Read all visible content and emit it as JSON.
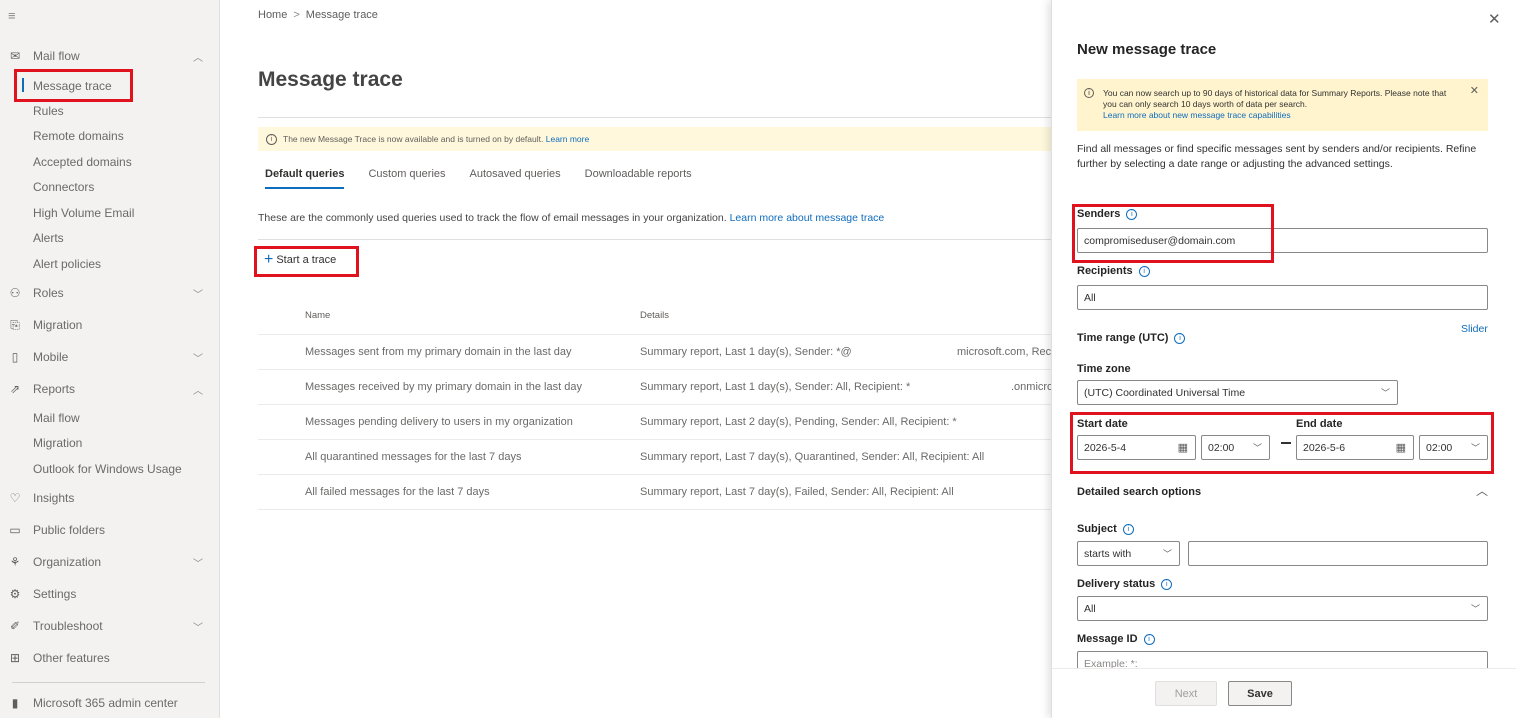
{
  "sidebar": {
    "menu_icon": "hamburger-icon",
    "mail_flow": {
      "label": "Mail flow",
      "icon": "mail-icon"
    },
    "mail_flow_items": [
      "Message trace",
      "Rules",
      "Remote domains",
      "Accepted domains",
      "Connectors",
      "High Volume Email",
      "Alerts",
      "Alert policies"
    ],
    "roles": {
      "label": "Roles",
      "icon": "roles-icon"
    },
    "migration": {
      "label": "Migration",
      "icon": "migration-icon"
    },
    "mobile": {
      "label": "Mobile",
      "icon": "mobile-icon"
    },
    "reports": {
      "label": "Reports",
      "icon": "reports-icon"
    },
    "reports_items": [
      "Mail flow",
      "Migration",
      "Outlook for Windows Usage"
    ],
    "insights": {
      "label": "Insights",
      "icon": "insights-icon"
    },
    "public_folders": {
      "label": "Public folders",
      "icon": "public-folders-icon"
    },
    "organization": {
      "label": "Organization",
      "icon": "organization-icon"
    },
    "settings": {
      "label": "Settings",
      "icon": "settings-icon"
    },
    "troubleshoot": {
      "label": "Troubleshoot",
      "icon": "troubleshoot-icon"
    },
    "other_features": {
      "label": "Other features",
      "icon": "grid-icon"
    },
    "admin_center": {
      "label": "Microsoft 365 admin center",
      "icon": "office-icon"
    }
  },
  "main": {
    "breadcrumb": {
      "home": "Home",
      "separator": ">",
      "current": "Message trace"
    },
    "title": "Message trace",
    "banner": {
      "text": "The new Message Trace is now available and is turned on by default.",
      "link": "Learn more"
    },
    "tabs": [
      "Default queries",
      "Custom queries",
      "Autosaved queries",
      "Downloadable reports"
    ],
    "description": {
      "text": "These are the commonly used queries used to track the flow of email messages in your organization.",
      "link": "Learn more about message trace"
    },
    "start_trace": {
      "plus": "+",
      "label": "Start a trace"
    },
    "columns": {
      "name": "Name",
      "details": "Details"
    },
    "rows": [
      {
        "name": "Messages sent from my primary domain in the last day",
        "details": "Summary report, Last 1 day(s), Sender: *@",
        "extra": "microsoft.com, Rec"
      },
      {
        "name": "Messages received by my primary domain in the last day",
        "details": "Summary report, Last 1 day(s), Sender: All, Recipient: *",
        "extra": ".onmicro"
      },
      {
        "name": "Messages pending delivery to users in my organization",
        "details": "Summary report, Last 2 day(s), Pending, Sender: All, Recipient: *",
        "extra": ""
      },
      {
        "name": "All quarantined messages for the last 7 days",
        "details": "Summary report, Last 7 day(s), Quarantined, Sender: All, Recipient: All",
        "extra": ""
      },
      {
        "name": "All failed messages for the last 7 days",
        "details": "Summary report, Last 7 day(s), Failed, Sender: All, Recipient: All",
        "extra": ""
      }
    ]
  },
  "panel": {
    "close": "✕",
    "title": "New message trace",
    "notice": {
      "line1": "You can now search up to 90 days of historical data for Summary Reports. Please note that you can only search 10 days worth of data per search.",
      "link": "Learn more about new message trace capabilities",
      "close": "✕"
    },
    "description": "Find all messages or find specific messages sent by senders and/or recipients. Refine further by selecting a date range or adjusting the advanced settings.",
    "senders": {
      "label": "Senders",
      "value": "compromiseduser@domain.com"
    },
    "recipients": {
      "label": "Recipients",
      "value": "All"
    },
    "time_range": {
      "label": "Time range (UTC)",
      "slider": "Slider"
    },
    "time_zone": {
      "label": "Time zone",
      "value": "(UTC) Coordinated Universal Time"
    },
    "start_date": {
      "label": "Start date",
      "date": "2026-5-4",
      "time": "02:00"
    },
    "end_date": {
      "label": "End date",
      "date": "2026-5-6",
      "time": "02:00"
    },
    "detailed": {
      "label": "Detailed search options"
    },
    "subject": {
      "label": "Subject",
      "operator": "starts with",
      "value": ""
    },
    "delivery_status": {
      "label": "Delivery status",
      "value": "All"
    },
    "message_id": {
      "label": "Message ID",
      "placeholder": "Example: *:"
    },
    "buttons": {
      "next": "Next",
      "save": "Save"
    }
  },
  "colors": {
    "accent": "#0f6cbd",
    "highlight": "#e0121e",
    "warning_bg": "#fff4ce",
    "banner_bg": "#fff8dc"
  }
}
